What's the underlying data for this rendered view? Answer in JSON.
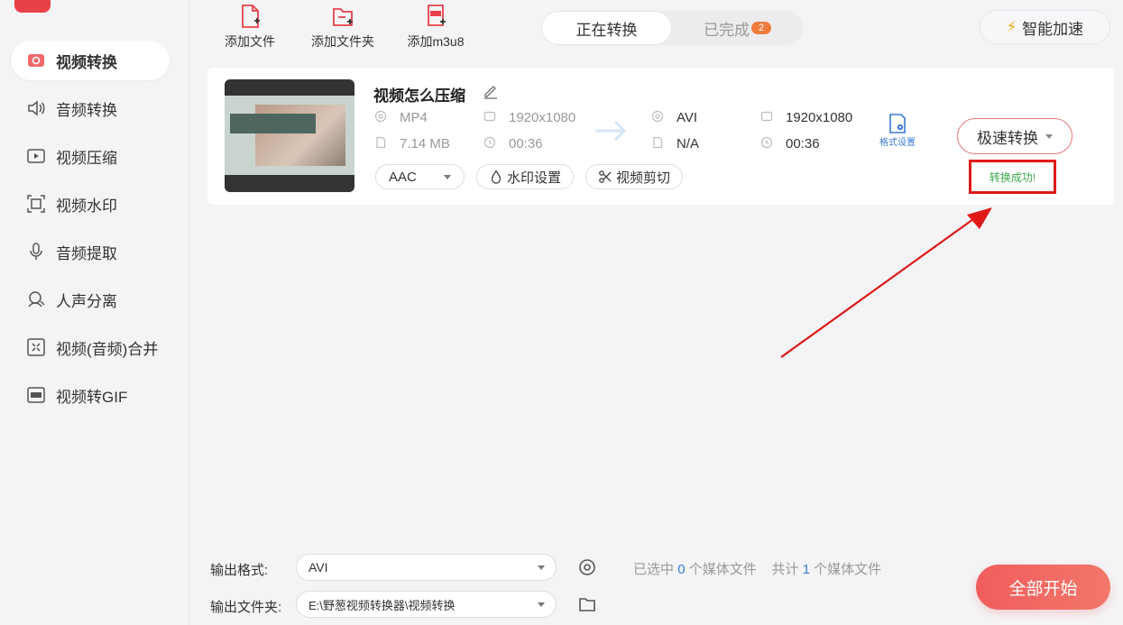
{
  "sidebar": {
    "items": [
      {
        "label": "视频转换",
        "icon": "video-convert-icon"
      },
      {
        "label": "音频转换",
        "icon": "audio-convert-icon"
      },
      {
        "label": "视频压缩",
        "icon": "video-compress-icon"
      },
      {
        "label": "视频水印",
        "icon": "video-watermark-icon"
      },
      {
        "label": "音频提取",
        "icon": "audio-extract-icon"
      },
      {
        "label": "人声分离",
        "icon": "vocal-separate-icon"
      },
      {
        "label": "视频(音频)合并",
        "icon": "merge-icon"
      },
      {
        "label": "视频转GIF",
        "icon": "gif-icon"
      }
    ],
    "active_index": 0
  },
  "toolbar": {
    "add_file": "添加文件",
    "add_folder": "添加文件夹",
    "add_m3u8": "添加m3u8"
  },
  "tabs": {
    "converting": "正在转换",
    "completed": "已完成",
    "completed_count": "2"
  },
  "accel_button": "智能加速",
  "file": {
    "title": "视频怎么压缩",
    "source": {
      "format": "MP4",
      "resolution": "1920x1080",
      "size": "7.14 MB",
      "duration": "00:36"
    },
    "target": {
      "format": "AVI",
      "resolution": "1920x1080",
      "size": "N/A",
      "duration": "00:36"
    },
    "format_setting": "格式设置",
    "audio_codec": "AAC",
    "watermark_setting": "水印设置",
    "video_cut": "视频剪切",
    "convert_mode": "极速转换",
    "status": "转换成功!"
  },
  "bottom": {
    "output_format_label": "输出格式:",
    "output_format_value": "AVI",
    "output_folder_label": "输出文件夹:",
    "output_folder_value": "E:\\野葱视频转换器\\视频转换",
    "status_prefix": "已选中",
    "selected_count": "0",
    "status_mid": "个媒体文件",
    "total_prefix": "共计",
    "total_count": "1",
    "total_suffix": "个媒体文件",
    "start_all": "全部开始"
  },
  "colors": {
    "accent_red": "#e8414a",
    "success_green": "#3aa64a",
    "link_blue": "#3a7bd5",
    "annotation_red": "#e01818"
  }
}
